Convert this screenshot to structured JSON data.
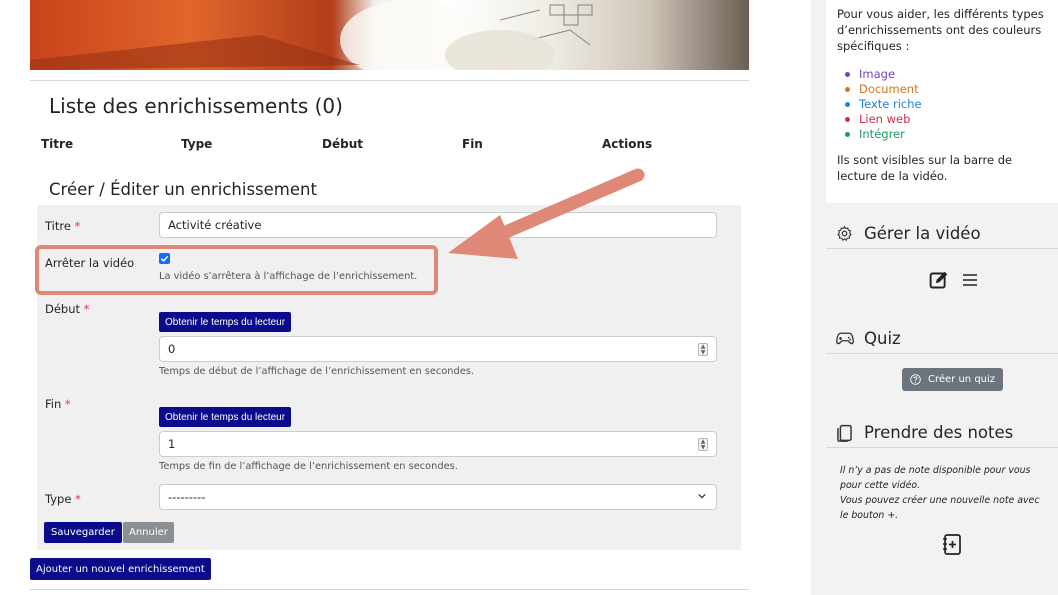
{
  "main": {
    "list_title": "Liste des enrichissements (0)",
    "columns": [
      "Titre",
      "Type",
      "Début",
      "Fin",
      "Actions"
    ],
    "form_title": "Créer / Éditer un enrichissement",
    "form": {
      "title_label": "Titre",
      "title_value": "Activité créative",
      "stop_label": "Arrêter la vidéo",
      "stop_checked": true,
      "stop_help": "La vidéo s’arrêtera à l’affichage de l’enrichissement.",
      "start_label": "Début",
      "start_button": "Obtenir le temps du lecteur",
      "start_value": "0",
      "start_help": "Temps de début de l’affichage de l’enrichissement en secondes.",
      "end_label": "Fin",
      "end_button": "Obtenir le temps du lecteur",
      "end_value": "1",
      "end_help": "Temps de fin de l’affichage de l’enrichissement en secondes.",
      "type_label": "Type",
      "type_value": "---------",
      "required_mark": "*",
      "save_label": "Sauvegarder",
      "cancel_label": "Annuler"
    },
    "add_button": "Ajouter un nouvel enrichissement"
  },
  "sidebar": {
    "intro": "Pour vous aider, les différents types d’enrichissements ont des couleurs spécifiques :",
    "legend": [
      {
        "label": "Image",
        "color": "#7b3fc4"
      },
      {
        "label": "Document",
        "color": "#d9731c"
      },
      {
        "label": "Texte riche",
        "color": "#1f7fd8"
      },
      {
        "label": "Lien web",
        "color": "#d62b4a"
      },
      {
        "label": "Intégrer",
        "color": "#1e9a63"
      }
    ],
    "visible_note": "Ils sont visibles sur la barre de lecture de la vidéo.",
    "manage_title": "Gérer la vidéo",
    "quiz_title": "Quiz",
    "quiz_button": "Créer un quiz",
    "notes_title": "Prendre des notes",
    "notes_empty_1": "Il n’y a pas de note disponible pour vous pour cette vidéo.",
    "notes_empty_2": "Vous pouvez créer une nouvelle note avec le bouton +."
  },
  "colors": {
    "primary": "#0b0b8c",
    "secondary": "#6c757d",
    "required": "#dc3545",
    "annotation": "#e08878"
  }
}
